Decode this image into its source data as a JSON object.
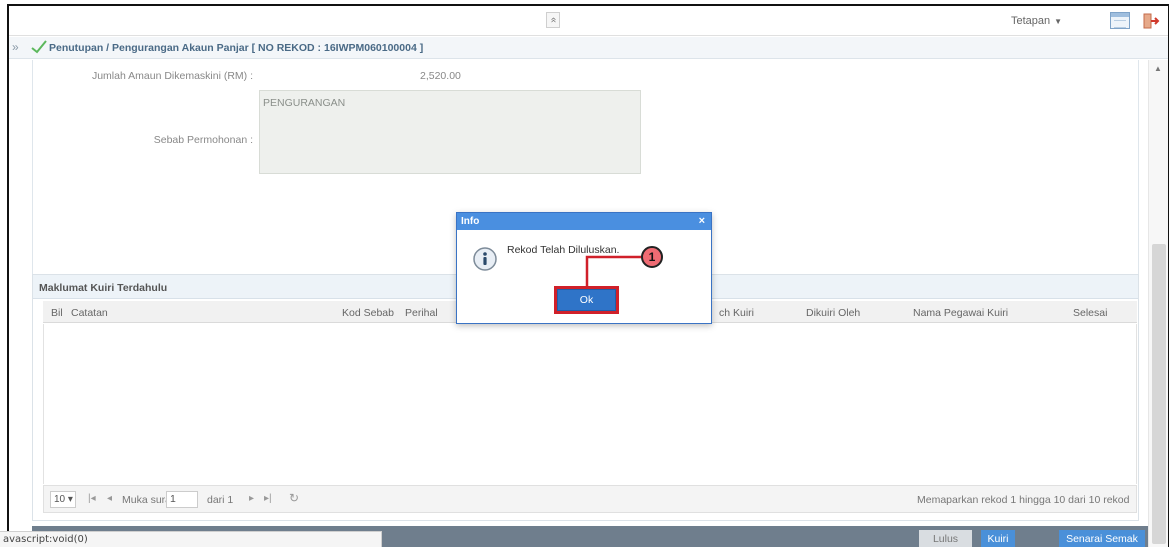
{
  "topbar": {
    "collapse_glyph": "«",
    "settings_label": "Tetapan",
    "settings_caret": "▼"
  },
  "titlebar": {
    "expand_glyph": "»",
    "title": "Penutupan / Pengurangan Akaun Panjar [ NO REKOD : 16IWPM060100004 ]"
  },
  "form": {
    "amount_label": "Jumlah Amaun Dikemaskini (RM) :",
    "amount_value": "2,520.00",
    "reason_label": "Sebab Permohonan :",
    "reason_value": "PENGURANGAN"
  },
  "query": {
    "section_title": "Maklumat Kuiri Terdahulu",
    "columns": [
      "Bil",
      "Catatan",
      "Kod Sebab",
      "Perihal",
      "ch Kuiri",
      "Dikuiri Oleh",
      "Nama Pegawai Kuiri",
      "Selesai"
    ],
    "pager": {
      "page_size": "10 ▾",
      "first": "|◂",
      "prev": "◂",
      "page_label": "Muka surat",
      "page_value": "1",
      "of_label": "dari 1",
      "next": "▸",
      "last": "▸|",
      "refresh": "↻",
      "summary": "Memaparkan rekod 1 hingga 10 dari 10 rekod"
    }
  },
  "actions": {
    "approve": "Lulus",
    "query": "Kuiri",
    "checklist": "Senarai Semak"
  },
  "status_bar": "avascript:void(0)",
  "modal": {
    "title": "Info",
    "close": "×",
    "message": "Rekod Telah Diluluskan.",
    "ok": "Ok"
  },
  "callout": {
    "number": "1"
  },
  "colors": {
    "accent": "#4a8fe0",
    "highlight": "#d0202a",
    "badge": "#ef6b73"
  }
}
